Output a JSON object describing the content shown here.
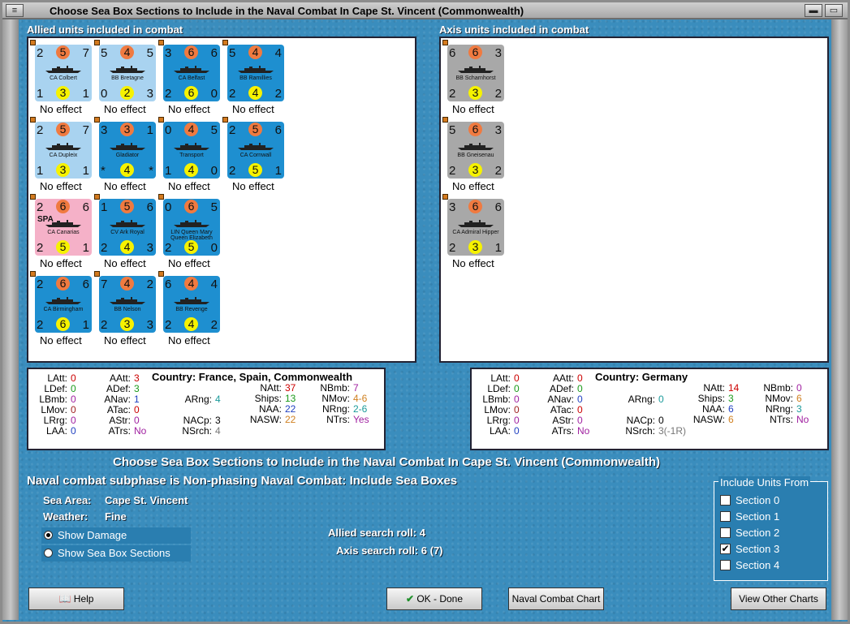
{
  "window": {
    "title": "Choose Sea Box Sections to Include in the Naval Combat In Cape St. Vincent (Commonwealth)",
    "min": "▬",
    "max": "▭"
  },
  "allied_label": "Allied units included in combat",
  "axis_label": "Axis units included in combat",
  "no_effect": "No effect",
  "allied_units": [
    {
      "name": "CA Colbert",
      "tl": "2",
      "tc": "5",
      "tr": "7",
      "bl": "1",
      "bc": "3",
      "br": "1",
      "color": "#a9d3f0"
    },
    {
      "name": "BB Bretagne",
      "tl": "5",
      "tc": "4",
      "tr": "5",
      "bl": "0",
      "bc": "2",
      "br": "3",
      "color": "#a9d3f0"
    },
    {
      "name": "CA Belfast",
      "tl": "3",
      "tc": "6",
      "tr": "6",
      "bl": "2",
      "bc": "6",
      "br": "0",
      "color": "#1e8fd0"
    },
    {
      "name": "BB Ramillies",
      "tl": "5",
      "tc": "4",
      "tr": "4",
      "bl": "2",
      "bc": "4",
      "br": "2",
      "color": "#1e8fd0"
    },
    {
      "name": "CA Dupleix",
      "tl": "2",
      "tc": "5",
      "tr": "7",
      "bl": "1",
      "bc": "3",
      "br": "1",
      "color": "#a9d3f0"
    },
    {
      "name": "Gladiator",
      "tl": "3",
      "tc": "3",
      "tr": "1",
      "bl": "*",
      "bc": "4",
      "br": "*",
      "color": "#1e8fd0"
    },
    {
      "name": "Transport",
      "tl": "0",
      "tc": "4",
      "tr": "5",
      "bl": "1",
      "bc": "4",
      "br": "0",
      "color": "#1e8fd0"
    },
    {
      "name": "CA Cornwall",
      "tl": "2",
      "tc": "5",
      "tr": "6",
      "bl": "2",
      "bc": "5",
      "br": "1",
      "color": "#1e8fd0"
    },
    {
      "name": "CA Canarias",
      "tag": "SPA",
      "tl": "2",
      "tc": "6",
      "tr": "6",
      "bl": "2",
      "bc": "5",
      "br": "1",
      "color": "#f5b1c8"
    },
    {
      "name": "CV Ark Royal",
      "tl": "1",
      "tc": "5",
      "tr": "6",
      "bl": "2",
      "bc": "4",
      "br": "3",
      "color": "#1e8fd0"
    },
    {
      "name": "LIN Queen Mary Queen Elizabeth",
      "tl": "0",
      "tc": "6",
      "tr": "5",
      "bl": "2",
      "bc": "5",
      "br": "0",
      "color": "#1e8fd0"
    },
    {
      "name": "CA Birmingham",
      "tl": "2",
      "tc": "6",
      "tr": "6",
      "bl": "2",
      "bc": "6",
      "br": "1",
      "color": "#1e8fd0"
    },
    {
      "name": "BB Nelson",
      "tl": "7",
      "tc": "4",
      "tr": "2",
      "bl": "2",
      "bc": "3",
      "br": "3",
      "color": "#1e8fd0"
    },
    {
      "name": "BB Revenge",
      "tl": "6",
      "tc": "4",
      "tr": "4",
      "bl": "2",
      "bc": "4",
      "br": "2",
      "color": "#1e8fd0"
    }
  ],
  "axis_units": [
    {
      "name": "BB Scharnhorst",
      "tl": "6",
      "tc": "6",
      "tr": "3",
      "bl": "2",
      "bc": "3",
      "br": "2",
      "color": "#a8a8a8"
    },
    {
      "name": "BB Gneisenau",
      "tl": "5",
      "tc": "6",
      "tr": "3",
      "bl": "2",
      "bc": "3",
      "br": "2",
      "color": "#a8a8a8"
    },
    {
      "name": "CA Admiral Hipper",
      "tl": "3",
      "tc": "6",
      "tr": "6",
      "bl": "2",
      "bc": "3",
      "br": "1",
      "color": "#a8a8a8"
    }
  ],
  "allied_stats": {
    "country": "Country: France, Spain, Commonwealth",
    "latt": "LAtt:",
    "latt_v": "0",
    "ldef": "LDef:",
    "ldef_v": "0",
    "lbmb": "LBmb:",
    "lbmb_v": "0",
    "lmov": "LMov:",
    "lmov_v": "0",
    "lrng": "LRrg:",
    "lrng_v": "0",
    "laa": "LAA:",
    "laa_v": "0",
    "aatt": "AAtt:",
    "aatt_v": "3",
    "adef": "ADef:",
    "adef_v": "3",
    "anav": "ANav:",
    "anav_v": "1",
    "atac": "ATac:",
    "atac_v": "0",
    "astr": "AStr:",
    "astr_v": "0",
    "atrs": "ATrs:",
    "atrs_v": "No",
    "arng": "ARng:",
    "arng_v": "4",
    "nacp": "NACp:",
    "nacp_v": "3",
    "nsrch": "NSrch:",
    "nsrch_v": "4",
    "natt": "NAtt:",
    "natt_v": "37",
    "ships": "Ships:",
    "ships_v": "13",
    "naa": "NAA:",
    "naa_v": "22",
    "nasw": "NASW:",
    "nasw_v": "22",
    "nbmb": "NBmb:",
    "nbmb_v": "7",
    "nmov": "NMov:",
    "nmov_v": "4-6",
    "nrng": "NRng:",
    "nrng_v": "2-6",
    "ntrs": "NTrs:",
    "ntrs_v": "Yes"
  },
  "axis_stats": {
    "country": "Country: Germany",
    "latt": "LAtt:",
    "latt_v": "0",
    "ldef": "LDef:",
    "ldef_v": "0",
    "lbmb": "LBmb:",
    "lbmb_v": "0",
    "lmov": "LMov:",
    "lmov_v": "0",
    "lrng": "LRrg:",
    "lrng_v": "0",
    "laa": "LAA:",
    "laa_v": "0",
    "aatt": "AAtt:",
    "aatt_v": "0",
    "adef": "ADef:",
    "adef_v": "0",
    "anav": "ANav:",
    "anav_v": "0",
    "atac": "ATac:",
    "atac_v": "0",
    "astr": "AStr:",
    "astr_v": "0",
    "atrs": "ATrs:",
    "atrs_v": "No",
    "arng": "ARng:",
    "arng_v": "0",
    "nacp": "NACp:",
    "nacp_v": "0",
    "nsrch": "NSrch:",
    "nsrch_v": "3(-1R)",
    "natt": "NAtt:",
    "natt_v": "14",
    "ships": "Ships:",
    "ships_v": "3",
    "naa": "NAA:",
    "naa_v": "6",
    "nasw": "NASW:",
    "nasw_v": "6",
    "nbmb": "NBmb:",
    "nbmb_v": "0",
    "nmov": "NMov:",
    "nmov_v": "6",
    "nrng": "NRng:",
    "nrng_v": "3",
    "ntrs": "NTrs:",
    "ntrs_v": "No"
  },
  "main_title": "Choose Sea Box Sections to Include in the Naval Combat In Cape St. Vincent (Commonwealth)",
  "subphase": "Naval combat subphase is Non-phasing Naval Combat: Include Sea Boxes",
  "sea_area_label": "Sea Area:",
  "sea_area": "Cape St. Vincent",
  "weather_label": "Weather:",
  "weather": "Fine",
  "radio_damage": "Show Damage",
  "radio_sections": "Show Sea Box Sections",
  "allied_search": "Allied search roll: 4",
  "axis_search": "Axis search roll: 6 (7)",
  "include_title": "Include Units From",
  "sections": [
    "Section 0",
    "Section 1",
    "Section 2",
    "Section 3",
    "Section 4"
  ],
  "sections_checked": [
    false,
    false,
    false,
    true,
    false
  ],
  "buttons": {
    "help": "Help",
    "ok": "OK - Done",
    "chart": "Naval Combat Chart",
    "other": "View Other Charts"
  }
}
